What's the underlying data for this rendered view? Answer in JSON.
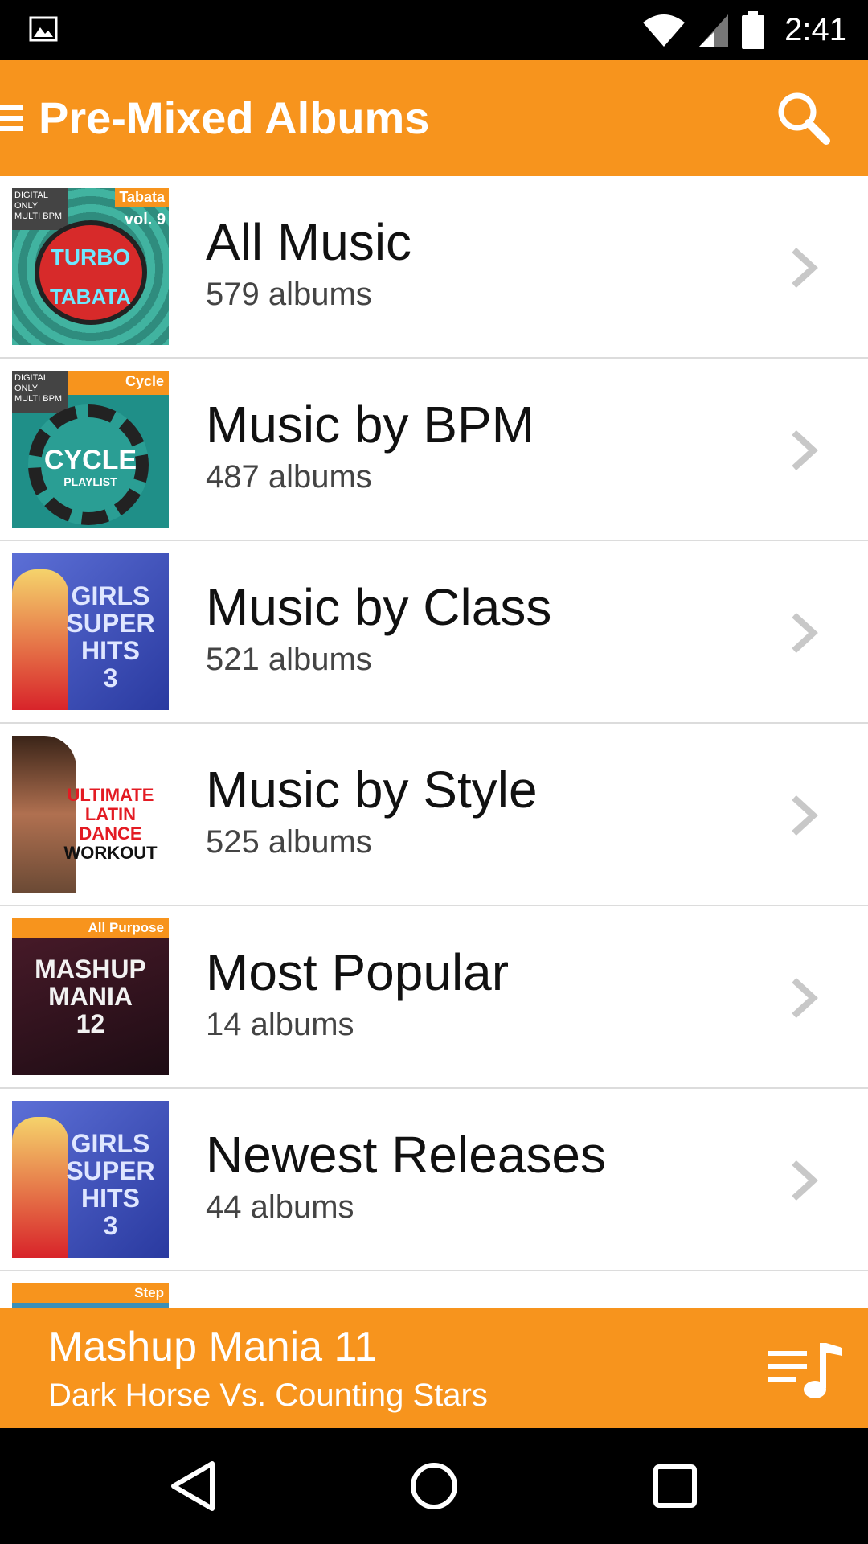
{
  "status_bar": {
    "time": "2:41",
    "left_icon": "image-notification-icon",
    "icons": [
      "wifi-icon",
      "cell-signal-icon",
      "battery-icon"
    ]
  },
  "app_bar": {
    "title": "Pre-Mixed Albums",
    "menu_icon": "menu-icon",
    "search_icon": "search-icon",
    "color": "#f7941d"
  },
  "list": {
    "items": [
      {
        "title": "All Music",
        "subtitle": "579 albums",
        "art": {
          "tag": "Tabata",
          "top_left": "DIGITAL ONLY MULTI BPM",
          "line1": "TURBO",
          "line2": "TABATA",
          "vol": "vol. 9"
        }
      },
      {
        "title": "Music by BPM",
        "subtitle": "487 albums",
        "art": {
          "tag": "Cycle",
          "top_left": "DIGITAL ONLY MULTI BPM",
          "line1": "CYCLE",
          "line2": "PLAYLIST"
        }
      },
      {
        "title": "Music by Class",
        "subtitle": "521 albums",
        "art": {
          "line1": "GIRLS",
          "line2": "SUPER",
          "line3": "HITS",
          "line4": "3"
        }
      },
      {
        "title": "Music by Style",
        "subtitle": "525 albums",
        "art": {
          "line1": "ULTIMATE",
          "line2": "LATIN",
          "line3": "DANCE",
          "line4": "WORKOUT"
        }
      },
      {
        "title": "Most Popular",
        "subtitle": "14 albums",
        "art": {
          "tag": "All Purpose",
          "line1": "MASHUP",
          "line2": "MANIA",
          "line3": "12"
        }
      },
      {
        "title": "Newest Releases",
        "subtitle": "44 albums",
        "art": {
          "line1": "GIRLS",
          "line2": "SUPER",
          "line3": "HITS",
          "line4": "3"
        }
      }
    ],
    "partial_item_tag": "Step"
  },
  "now_playing": {
    "title": "Mashup Mania 11",
    "subtitle": "Dark Horse Vs. Counting Stars",
    "queue_icon": "playlist-music-icon"
  },
  "nav_bar": {
    "icons": [
      "back-icon",
      "home-icon",
      "recents-icon"
    ]
  }
}
